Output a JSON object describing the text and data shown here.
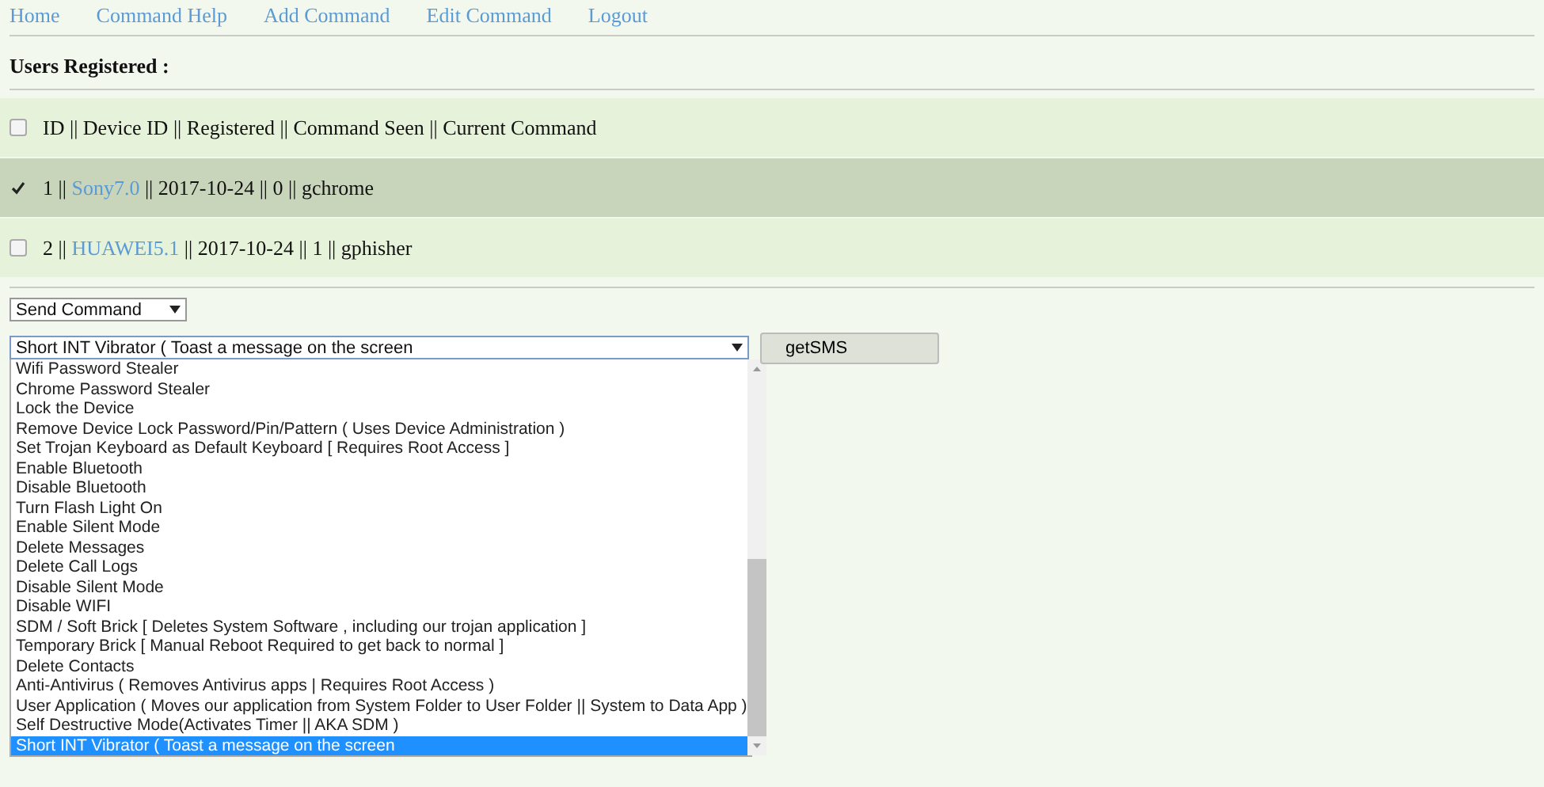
{
  "nav": [
    "Home",
    "Command Help",
    "Add Command",
    "Edit Command",
    "Logout"
  ],
  "heading": "Users Registered :",
  "users": {
    "header": {
      "text": "ID || Device ID || Registered || Command Seen || Current Command",
      "checked": false
    },
    "rows": [
      {
        "before": "1 ||",
        "device": "Sony7.0",
        "after": "|| 2017-10-24 || 0 || gchrome",
        "checked": true,
        "selected": true
      },
      {
        "before": "2 ||",
        "device": "HUAWEI5.1",
        "after": "|| 2017-10-24 || 1 || gphisher",
        "checked": false,
        "selected": false
      }
    ]
  },
  "send_select": {
    "value": "Send Command"
  },
  "command_select": {
    "value": "Short INT Vibrator ( Toast a message on the screen",
    "expanded": true,
    "options": [
      {
        "label": "Wifi Password Stealer",
        "selected": false
      },
      {
        "label": "Chrome Password Stealer",
        "selected": false
      },
      {
        "label": "Lock the Device",
        "selected": false
      },
      {
        "label": "Remove Device Lock Password/Pin/Pattern ( Uses Device Administration )",
        "selected": false
      },
      {
        "label": "Set Trojan Keyboard as Default Keyboard [ Requires Root Access ]",
        "selected": false
      },
      {
        "label": "Enable Bluetooth",
        "selected": false
      },
      {
        "label": "Disable Bluetooth",
        "selected": false
      },
      {
        "label": "Turn Flash Light On",
        "selected": false
      },
      {
        "label": "Enable Silent Mode",
        "selected": false
      },
      {
        "label": "Delete Messages",
        "selected": false
      },
      {
        "label": "Delete Call Logs",
        "selected": false
      },
      {
        "label": "Disable Silent Mode",
        "selected": false
      },
      {
        "label": "Disable WIFI",
        "selected": false
      },
      {
        "label": "SDM / Soft Brick [ Deletes System Software , including our trojan application ]",
        "selected": false
      },
      {
        "label": "Temporary Brick [ Manual Reboot Required to get back to normal ]",
        "selected": false
      },
      {
        "label": "Delete Contacts",
        "selected": false
      },
      {
        "label": "Anti-Antivirus ( Removes Antivirus apps | Requires Root Access )",
        "selected": false
      },
      {
        "label": "User Application ( Moves our application from System Folder to User Folder || System to Data App )",
        "selected": false
      },
      {
        "label": "Self Destructive Mode(Activates Timer || AKA SDM )",
        "selected": false
      },
      {
        "label": "Short INT Vibrator ( Toast a message on the screen",
        "selected": true
      }
    ]
  },
  "button": "getSMS"
}
